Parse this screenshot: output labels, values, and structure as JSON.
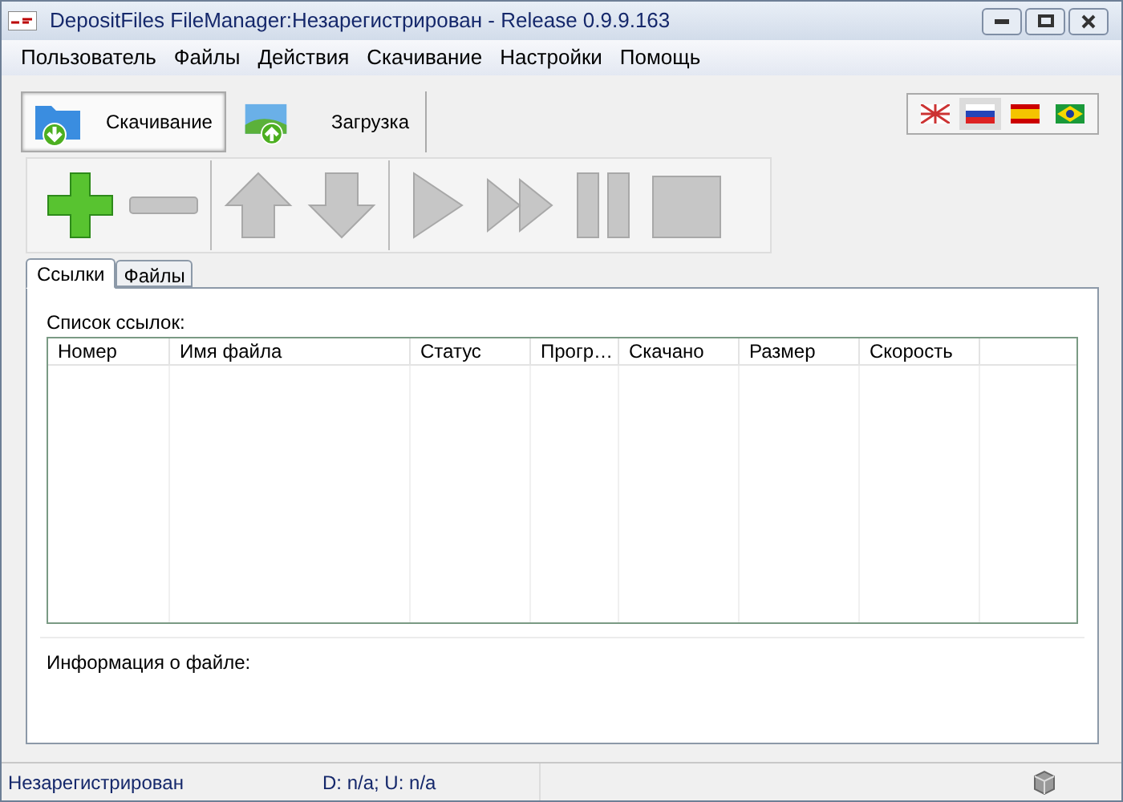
{
  "window": {
    "title": "DepositFiles FileManager:Незарегистрирован - Release 0.9.9.163"
  },
  "menu": [
    "Пользователь",
    "Файлы",
    "Действия",
    "Скачивание",
    "Настройки",
    "Помощь"
  ],
  "mode_tabs": [
    {
      "label": "Скачивание",
      "kind": "download",
      "selected": true
    },
    {
      "label": "Загрузка",
      "kind": "upload",
      "selected": false
    }
  ],
  "languages": [
    {
      "kind": "uk",
      "selected": false
    },
    {
      "kind": "ru",
      "selected": true
    },
    {
      "kind": "es",
      "selected": false
    },
    {
      "kind": "br",
      "selected": false
    }
  ],
  "toolbar": [
    {
      "kind": "add",
      "disabled": false
    },
    {
      "kind": "remove",
      "disabled": true
    },
    {
      "kind": "up",
      "disabled": true
    },
    {
      "kind": "down",
      "disabled": true
    },
    {
      "kind": "play",
      "disabled": true
    },
    {
      "kind": "play-all",
      "disabled": true
    },
    {
      "kind": "pause",
      "disabled": true
    },
    {
      "kind": "stop",
      "disabled": true
    }
  ],
  "tabs": [
    {
      "label": "Ссылки",
      "selected": true
    },
    {
      "label": "Файлы",
      "selected": false
    }
  ],
  "links_label": "Список ссылок:",
  "table": {
    "columns": [
      "Номер",
      "Имя файла",
      "Статус",
      "Прогр…",
      "Скачано",
      "Размер",
      "Скорость"
    ]
  },
  "file_info_label": "Информация о файле:",
  "status_bar": {
    "registration": "Незарегистрирован",
    "transfer": "D: n/a; U: n/a"
  }
}
